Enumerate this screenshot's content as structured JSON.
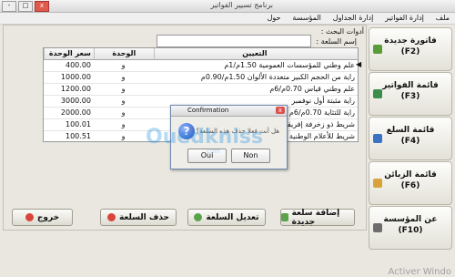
{
  "window": {
    "title": "برنامج تسيير الفواتير",
    "controls": [
      "-",
      "□",
      "x"
    ]
  },
  "menu": [
    "ملف",
    "إدارة الفواتير",
    "إدارة الجداول",
    "المؤسسة",
    "حول"
  ],
  "search": {
    "tools_label": "أدوات البحث :",
    "name_label": "إسم السلعة :",
    "value": ""
  },
  "table": {
    "headers": [
      "سعر الوحدة",
      "الوحدة",
      "التعيين"
    ],
    "rows": [
      {
        "price": "400.00",
        "unit": "و",
        "desc": "علم وطني للمؤسسات العمومية 1.50م/1م"
      },
      {
        "price": "1000.00",
        "unit": "و",
        "desc": "راية من الحجم الكبير متعددة الألوان 1.50م/0.90م"
      },
      {
        "price": "1200.00",
        "unit": "و",
        "desc": "علم وطني قياس 0.70م/6م"
      },
      {
        "price": "3000.00",
        "unit": "و",
        "desc": "راية مثبتة أول نوفمبر"
      },
      {
        "price": "2000.00",
        "unit": "و",
        "desc": "راية للتثاية 0.70م/6م"
      },
      {
        "price": "100.01",
        "unit": "و",
        "desc": "شريط ذو زخرفة إفريقية"
      },
      {
        "price": "100.51",
        "unit": "و",
        "desc": "شريط للأعلام الوطنية بشبك"
      }
    ]
  },
  "sidebar": [
    {
      "label": "فاتورة جديدة",
      "key": "(F2)",
      "color": "#5a9c3a"
    },
    {
      "label": "قائمة الفواتير",
      "key": "(F3)",
      "color": "#3c8d4a"
    },
    {
      "label": "قائمة السلع",
      "key": "(F4)",
      "color": "#3a73c4"
    },
    {
      "label": "قائمة الزبائن",
      "key": "(F6)",
      "color": "#d9a23b"
    },
    {
      "label": "عن المؤسسة",
      "key": "(F10)",
      "color": "#6c6c6c"
    }
  ],
  "buttons": {
    "exit": "خروج",
    "delete": "حذف السلعة",
    "edit": "تعديل السلعة",
    "add": "إضافة سلعة جديدة"
  },
  "dialog": {
    "title": "Confirmation",
    "message": "هل أنت فعلا حذف هذه السلعة؟",
    "yes": "Oui",
    "no": "Non"
  },
  "watermark": {
    "brand": "Ouedkniss",
    "sub": ".com"
  },
  "os_notice": "Activer Windo"
}
